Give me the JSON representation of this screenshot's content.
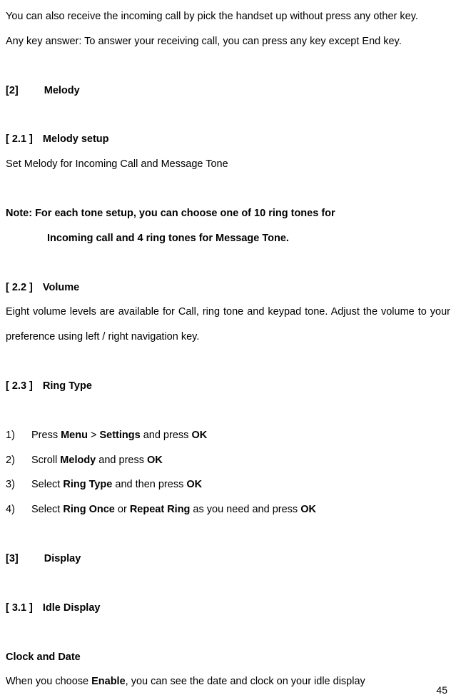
{
  "intro": {
    "p1": "You can also receive the incoming call by pick the handset up without press any other key.",
    "p2": "Any key answer: To answer your receiving call, you can press any key except End key."
  },
  "s2": {
    "num": "[2]",
    "title": "Melody"
  },
  "s21": {
    "num": "[ 2.1 ]",
    "title": "Melody setup",
    "body": "Set Melody for Incoming Call and Message Tone"
  },
  "note": {
    "l1": "Note: For each tone setup, you can choose one of 10 ring tones for",
    "l2": "Incoming call and 4 ring tones for Message Tone."
  },
  "s22": {
    "num": "[ 2.2 ]",
    "title": "Volume",
    "body": "Eight volume levels are available for Call, ring tone and keypad tone. Adjust the volume to your preference using left / right navigation key."
  },
  "s23": {
    "num": "[ 2.3 ]",
    "title": "Ring Type",
    "steps": [
      {
        "n": "1)",
        "pre": "Press ",
        "b1": "Menu",
        "mid1": " > ",
        "b2": "Settings",
        "mid2": " and press ",
        "b3": "OK",
        "post": ""
      },
      {
        "n": "2)",
        "pre": "Scroll ",
        "b1": "Melody",
        "mid1": " and press ",
        "b2": "OK",
        "mid2": "",
        "b3": "",
        "post": ""
      },
      {
        "n": "3)",
        "pre": "Select ",
        "b1": "Ring Type",
        "mid1": " and then press ",
        "b2": "OK",
        "mid2": "",
        "b3": "",
        "post": ""
      },
      {
        "n": "4)",
        "pre": "Select ",
        "b1": "Ring Once",
        "mid1": " or ",
        "b2": "Repeat Ring",
        "mid2": " as you need and press ",
        "b3": "OK",
        "post": ""
      }
    ]
  },
  "s3": {
    "num": "[3]",
    "title": "Display"
  },
  "s31": {
    "num": "[ 3.1 ]",
    "title": "Idle Display"
  },
  "clock": {
    "h": "Clock and Date",
    "pre": "When you choose ",
    "b": "Enable",
    "post": ", you can see the date and clock on your idle display"
  },
  "page": "45"
}
